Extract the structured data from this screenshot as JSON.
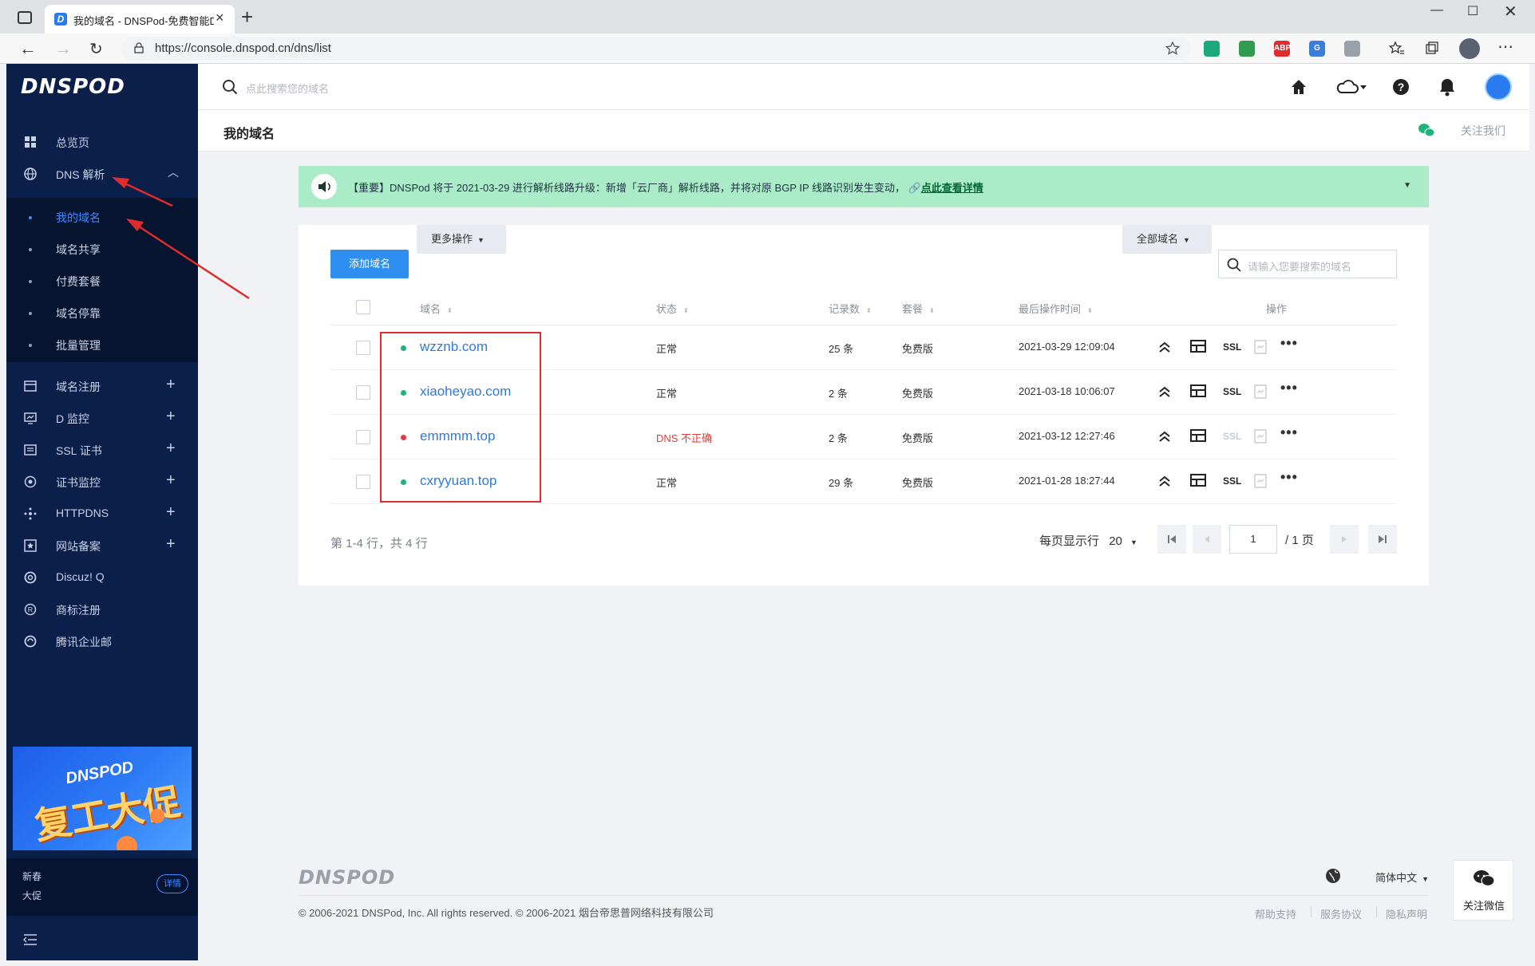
{
  "browser": {
    "tab_title": "我的域名 - DNSPod-免费智能DNS",
    "favicon_letter": "D",
    "url": "https://console.dnspod.cn/dns/list",
    "extensions": [
      {
        "name": "screen-capture-icon",
        "text": "",
        "color": "#19a97b"
      },
      {
        "name": "shield-icon",
        "text": "",
        "color": "#2e9d4f"
      },
      {
        "name": "adblock-icon",
        "text": "ABP",
        "color": "#e02c2c"
      },
      {
        "name": "translate-icon",
        "text": "G",
        "color": "#3b7ddd"
      },
      {
        "name": "bird-icon",
        "text": "",
        "color": "#9aa0a8"
      }
    ]
  },
  "sidebar": {
    "logo": "DNSPOD",
    "overview": "总览页",
    "dns": "DNS 解析",
    "sub": [
      "我的域名",
      "域名共享",
      "付费套餐",
      "域名停靠",
      "批量管理"
    ],
    "active_sub": 0,
    "items": [
      {
        "label": "域名注册",
        "icon": "domain-register-icon"
      },
      {
        "label": "D 监控",
        "icon": "monitor-icon"
      },
      {
        "label": "SSL 证书",
        "icon": "ssl-cert-icon"
      },
      {
        "label": "证书监控",
        "icon": "cert-monitor-icon"
      },
      {
        "label": "HTTPDNS",
        "icon": "httpdns-icon"
      },
      {
        "label": "网站备案",
        "icon": "record-filing-icon"
      },
      {
        "label": "Discuz! Q",
        "icon": "discuz-icon"
      },
      {
        "label": "商标注册",
        "icon": "trademark-icon"
      },
      {
        "label": "腾讯企业邮",
        "icon": "mail-icon"
      }
    ],
    "promo": {
      "brand": "DNSPOD",
      "headline": "复工大促"
    },
    "promo_foot": {
      "line1": "新春",
      "line2": "大促",
      "button": "详情"
    }
  },
  "topbar": {
    "search_placeholder": "点此搜索您的域名"
  },
  "page": {
    "title": "我的域名",
    "follow_us": "关注我们"
  },
  "notice": {
    "text": "【重要】DNSPod 将于 2021-03-29 进行解析线路升级：新增「云厂商」解析线路，并将对原 BGP IP 线路识别发生变动，",
    "link": "点此查看详情"
  },
  "toolbar": {
    "add_domain": "添加域名",
    "more_actions": "更多操作",
    "filter": "全部域名",
    "search_placeholder": "请输入您要搜索的域名"
  },
  "table": {
    "headers": {
      "domain": "域名",
      "status": "状态",
      "records": "记录数",
      "plan": "套餐",
      "last_op": "最后操作时间",
      "ops": "操作"
    },
    "rows": [
      {
        "domain": "wzznb.com",
        "status": "正常",
        "ok": true,
        "records": "25 条",
        "plan": "免费版",
        "time": "2021-03-29 12:09:04",
        "ssl": "SSL"
      },
      {
        "domain": "xiaoheyao.com",
        "status": "正常",
        "ok": true,
        "records": "2 条",
        "plan": "免费版",
        "time": "2021-03-18 10:06:07",
        "ssl": "SSL"
      },
      {
        "domain": "emmmm.top",
        "status": "DNS 不正确",
        "ok": false,
        "records": "2 条",
        "plan": "免费版",
        "time": "2021-03-12 12:27:46",
        "ssl": "SSL"
      },
      {
        "domain": "cxryyuan.top",
        "status": "正常",
        "ok": true,
        "records": "29 条",
        "plan": "免费版",
        "time": "2021-01-28 18:27:44",
        "ssl": "SSL"
      }
    ]
  },
  "pagination": {
    "summary": "第 1-4 行，共 4 行",
    "per_page_label": "每页显示行",
    "per_page": "20",
    "current": "1",
    "total": "/ 1 页"
  },
  "footer": {
    "logo": "DNSPOD",
    "language": "简体中文",
    "copyright": "© 2006-2021 DNSPod, Inc. All rights reserved. © 2006-2021 烟台帝思普网络科技有限公司",
    "links": [
      "帮助支持",
      "服务协议",
      "隐私声明"
    ]
  },
  "float": {
    "wechat": "关注微信"
  },
  "colors": {
    "sidebar_bg": "#0a1f4a",
    "accent": "#2e8ff0",
    "ok": "#1db37a",
    "error": "#e03c3c",
    "notice_bg": "#a9ecc7",
    "highlight": "#e02c2c"
  }
}
